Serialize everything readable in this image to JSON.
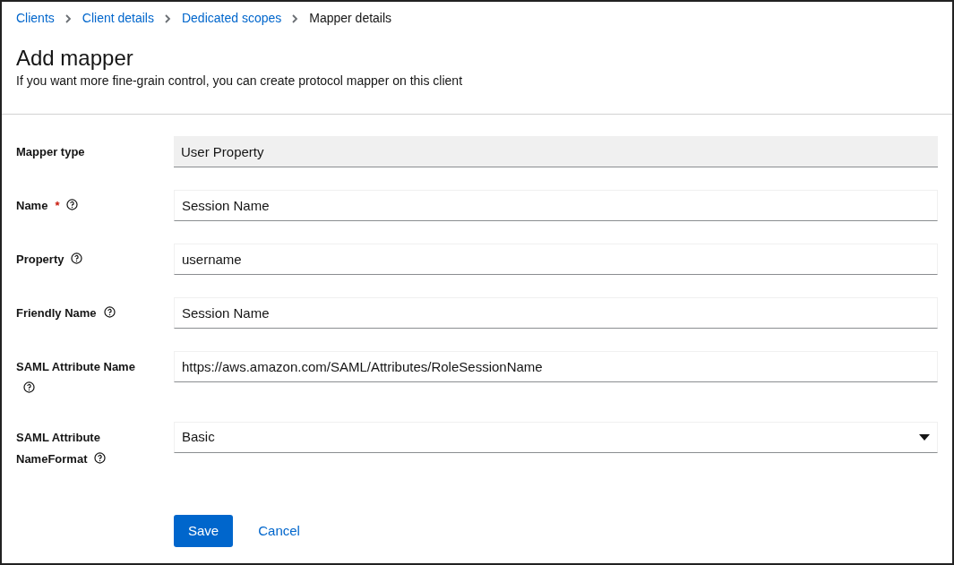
{
  "breadcrumbs": [
    {
      "label": "Clients",
      "link": true
    },
    {
      "label": "Client details",
      "link": true
    },
    {
      "label": "Dedicated scopes",
      "link": true
    },
    {
      "label": "Mapper details",
      "link": false
    }
  ],
  "title": "Add mapper",
  "subtitle": "If you want more fine-grain control, you can create protocol mapper on this client",
  "fields": [
    {
      "label": "Mapper type",
      "kind": "readonly",
      "help": false,
      "value": "User Property"
    },
    {
      "label": "Name",
      "kind": "text",
      "required_mark": "*",
      "help": true,
      "value": "Session Name"
    },
    {
      "label": "Property",
      "kind": "text",
      "help": true,
      "value": "username"
    },
    {
      "label": "Friendly Name",
      "kind": "text",
      "help": true,
      "value": "Session Name"
    },
    {
      "label": "SAML Attribute Name",
      "kind": "text",
      "help": true,
      "value": "https://aws.amazon.com/SAML/Attributes/RoleSessionName"
    },
    {
      "label": "SAML Attribute NameFormat",
      "kind": "select",
      "help": true,
      "value": "Basic"
    }
  ],
  "buttons": [
    {
      "label": "Save",
      "kind": "primary"
    },
    {
      "label": "Cancel",
      "kind": "link"
    }
  ]
}
